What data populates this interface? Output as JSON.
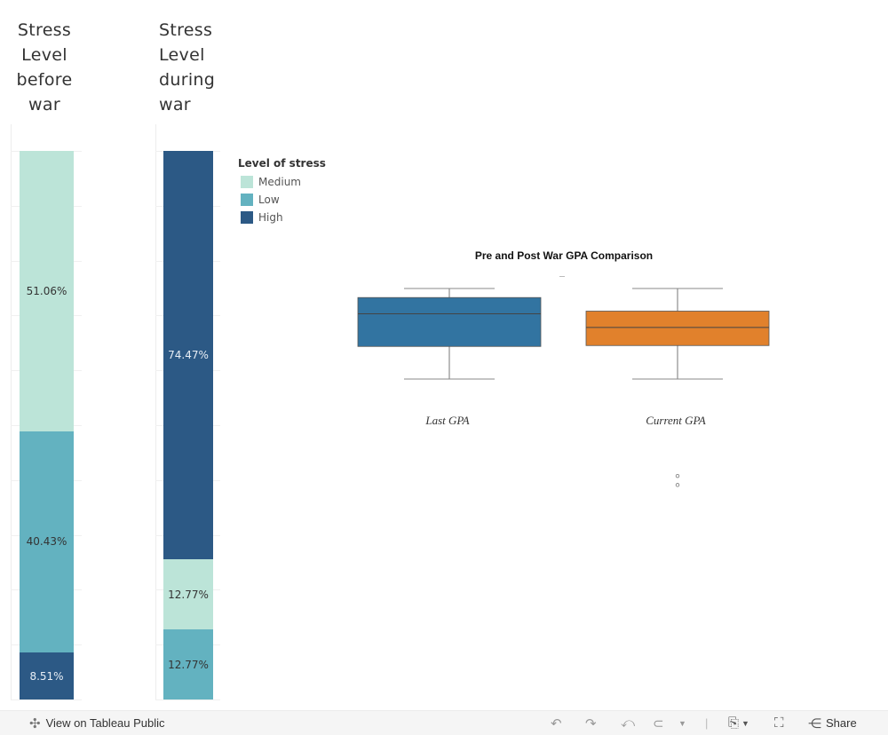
{
  "sheets": {
    "before": {
      "title": "Stress Level before war"
    },
    "during": {
      "title": "Stress Level during war"
    }
  },
  "legend": {
    "title": "Level of stress",
    "items": [
      {
        "label": "Medium",
        "color": "#bce4d8"
      },
      {
        "label": "Low",
        "color": "#63b2c0"
      },
      {
        "label": "High",
        "color": "#2c5985"
      }
    ]
  },
  "chart_data": [
    {
      "type": "bar",
      "title": "Stress Level before war",
      "stacked": true,
      "orientation": "vertical-100%",
      "series": [
        {
          "name": "Medium",
          "value": 51.06,
          "label": "51.06%",
          "color": "#bce4d8"
        },
        {
          "name": "Low",
          "value": 40.43,
          "label": "40.43%",
          "color": "#63b2c0"
        },
        {
          "name": "High",
          "value": 8.51,
          "label": "8.51%",
          "color": "#2c5985"
        }
      ]
    },
    {
      "type": "bar",
      "title": "Stress Level during war",
      "stacked": true,
      "orientation": "vertical-100%",
      "series": [
        {
          "name": "High",
          "value": 74.47,
          "label": "74.47%",
          "color": "#2c5985"
        },
        {
          "name": "Medium",
          "value": 12.77,
          "label": "12.77%",
          "color": "#bce4d8"
        },
        {
          "name": "Low",
          "value": 12.77,
          "label": "12.77%",
          "color": "#63b2c0"
        }
      ]
    },
    {
      "type": "boxplot",
      "title": "Pre and Post War GPA Comparison",
      "categories": [
        "Last GPA",
        "Current GPA"
      ],
      "boxes": [
        {
          "name": "Last GPA",
          "whisker_high": 0.0,
          "q3": 0.1,
          "median": 0.28,
          "q1": 0.64,
          "whisker_low": 1.0,
          "outliers": [],
          "color": "#3274a1"
        },
        {
          "name": "Current GPA",
          "whisker_high": 0.0,
          "q3": 0.25,
          "median": 0.43,
          "q1": 0.63,
          "whisker_low": 1.0,
          "outliers": [
            2.07,
            2.17
          ],
          "color": "#e1812c"
        }
      ],
      "note": "relative positions only; no axis scale shown"
    }
  ],
  "footer": {
    "view_label": "View on Tableau Public",
    "share_label": "Share"
  }
}
